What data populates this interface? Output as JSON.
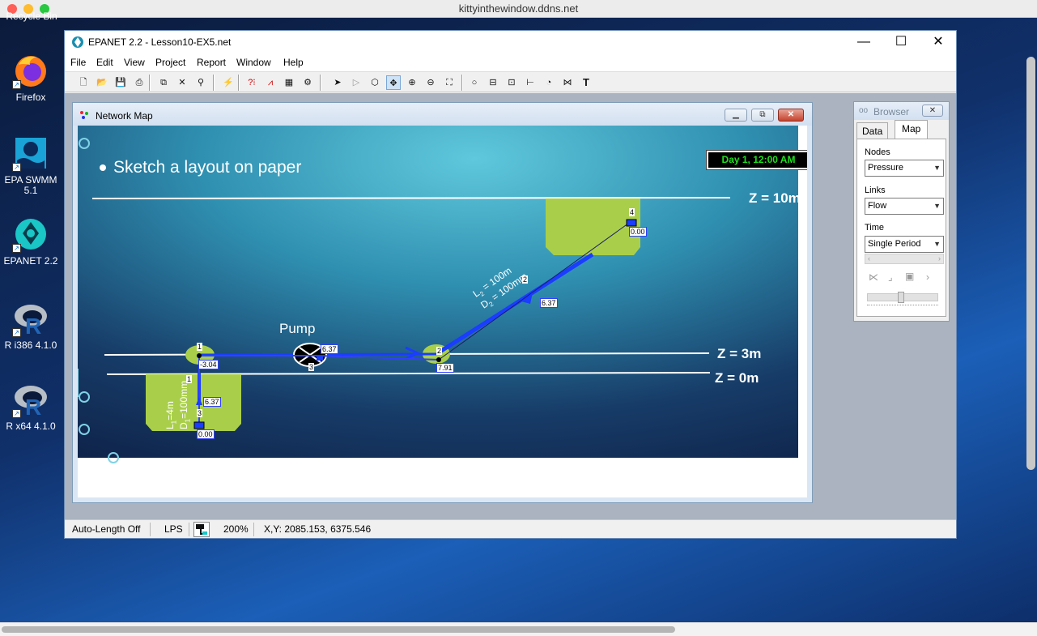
{
  "viewer": {
    "title": "kittyinthewindow.ddns.net"
  },
  "desktop": {
    "recycle_label": "Recycle Bin",
    "icons": [
      {
        "label": "Firefox",
        "icon": "firefox-icon"
      },
      {
        "label": "EPA SWMM 5.1",
        "icon": "epa-swmm-icon"
      },
      {
        "label": "EPANET 2.2",
        "icon": "epanet-icon"
      },
      {
        "label": "R i386 4.1.0",
        "icon": "r-icon"
      },
      {
        "label": "R x64 4.1.0",
        "icon": "r-icon"
      }
    ]
  },
  "app": {
    "title": "EPANET 2.2 - Lesson10-EX5.net",
    "menu": [
      "File",
      "Edit",
      "View",
      "Project",
      "Report",
      "Window",
      "Help"
    ],
    "toolbar": [
      "new-file",
      "open",
      "save",
      "print",
      "copy",
      "delete",
      "find",
      "run",
      "query",
      "graph",
      "table",
      "options",
      "select",
      "select-vertex",
      "select-region",
      "pan",
      "zoom-in",
      "zoom-out",
      "full-extent",
      "add-junction",
      "add-reservoir",
      "add-tank",
      "add-pipe",
      "add-pump",
      "add-valve",
      "add-label"
    ],
    "network_map": {
      "title": "Network Map",
      "clock": "Day 1, 12:00 AM",
      "slide_bullet": "Sketch a layout on paper",
      "levels": [
        "Z = 10m",
        "Z = 3m",
        "Z = 0m"
      ],
      "pump_label": "Pump",
      "pipe1_label_a": "L",
      "pipe1_label_a_sub": "1",
      "pipe1_label_b": "=4m",
      "pipe1_label_c": "D",
      "pipe1_label_c_sub": "1",
      "pipe1_label_d": "=100mm",
      "pipe2_label_a": "L",
      "pipe2_label_a_sub": "2",
      "pipe2_label_b": " = 100m",
      "pipe2_label_c": "D",
      "pipe2_label_c_sub": "2",
      "pipe2_label_d": " = 100mm",
      "node_ids": [
        "1",
        "2",
        "3",
        "4",
        "1",
        "3"
      ],
      "values": {
        "node1_pressure": "-3.04",
        "pump_flow": "6.37",
        "node2_pressure": "7.91",
        "pipe2_flow": "6.37",
        "node4_pressure": "0.00",
        "pipe1_flow": "6.37",
        "node3_pressure": "0.00",
        "pump_id": "3",
        "pipe2_id": "2"
      }
    },
    "browser": {
      "title": "Browser",
      "tabs": [
        "Data",
        "Map"
      ],
      "active_tab": "Map",
      "nodes_label": "Nodes",
      "nodes_value": "Pressure",
      "links_label": "Links",
      "links_value": "Flow",
      "time_label": "Time",
      "time_value": "Single Period"
    },
    "status": {
      "auto_length": "Auto-Length Off",
      "units": "LPS",
      "zoom": "200%",
      "coords": "X,Y: 2085.153, 6375.546"
    }
  },
  "colors": {
    "accent": "#1a3dff",
    "slide_green": "#a9cf4a",
    "clock_green": "#1ee01e"
  }
}
